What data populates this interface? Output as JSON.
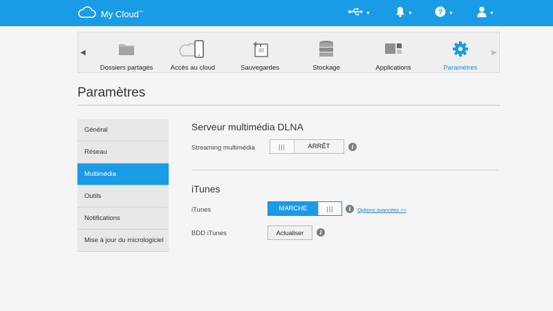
{
  "header": {
    "app_name": "My Cloud",
    "trademark": "™",
    "icons": [
      "usb-icon",
      "bell-icon",
      "help-icon",
      "user-icon"
    ]
  },
  "nav": {
    "items": [
      {
        "label": "Dossiers partagés",
        "icon": "folder-icon"
      },
      {
        "label": "Accès au cloud",
        "icon": "cloud-device-icon"
      },
      {
        "label": "Sauvegardes",
        "icon": "backup-icon"
      },
      {
        "label": "Stockage",
        "icon": "storage-icon"
      },
      {
        "label": "Applications",
        "icon": "apps-icon"
      },
      {
        "label": "Paramètres",
        "icon": "gear-icon",
        "active": true
      }
    ]
  },
  "page": {
    "title": "Paramètres"
  },
  "sidebar": {
    "items": [
      {
        "label": "Général"
      },
      {
        "label": "Réseau"
      },
      {
        "label": "Multimédia",
        "active": true
      },
      {
        "label": "Outils"
      },
      {
        "label": "Notifications"
      },
      {
        "label": "Mise à jour du micrologiciel"
      }
    ]
  },
  "dlna": {
    "title": "Serveur multimédia DLNA",
    "streaming_label": "Streaming multimédia",
    "streaming_state": "ARRÊT"
  },
  "itunes": {
    "title": "iTunes",
    "itunes_label": "iTunes",
    "itunes_state": "MARCHE",
    "advanced_link": "Options avancées >>",
    "db_label": "BDD iTunes",
    "refresh_button": "Actualiser"
  },
  "colors": {
    "accent": "#1a9be6",
    "link": "#1a7fc7"
  }
}
